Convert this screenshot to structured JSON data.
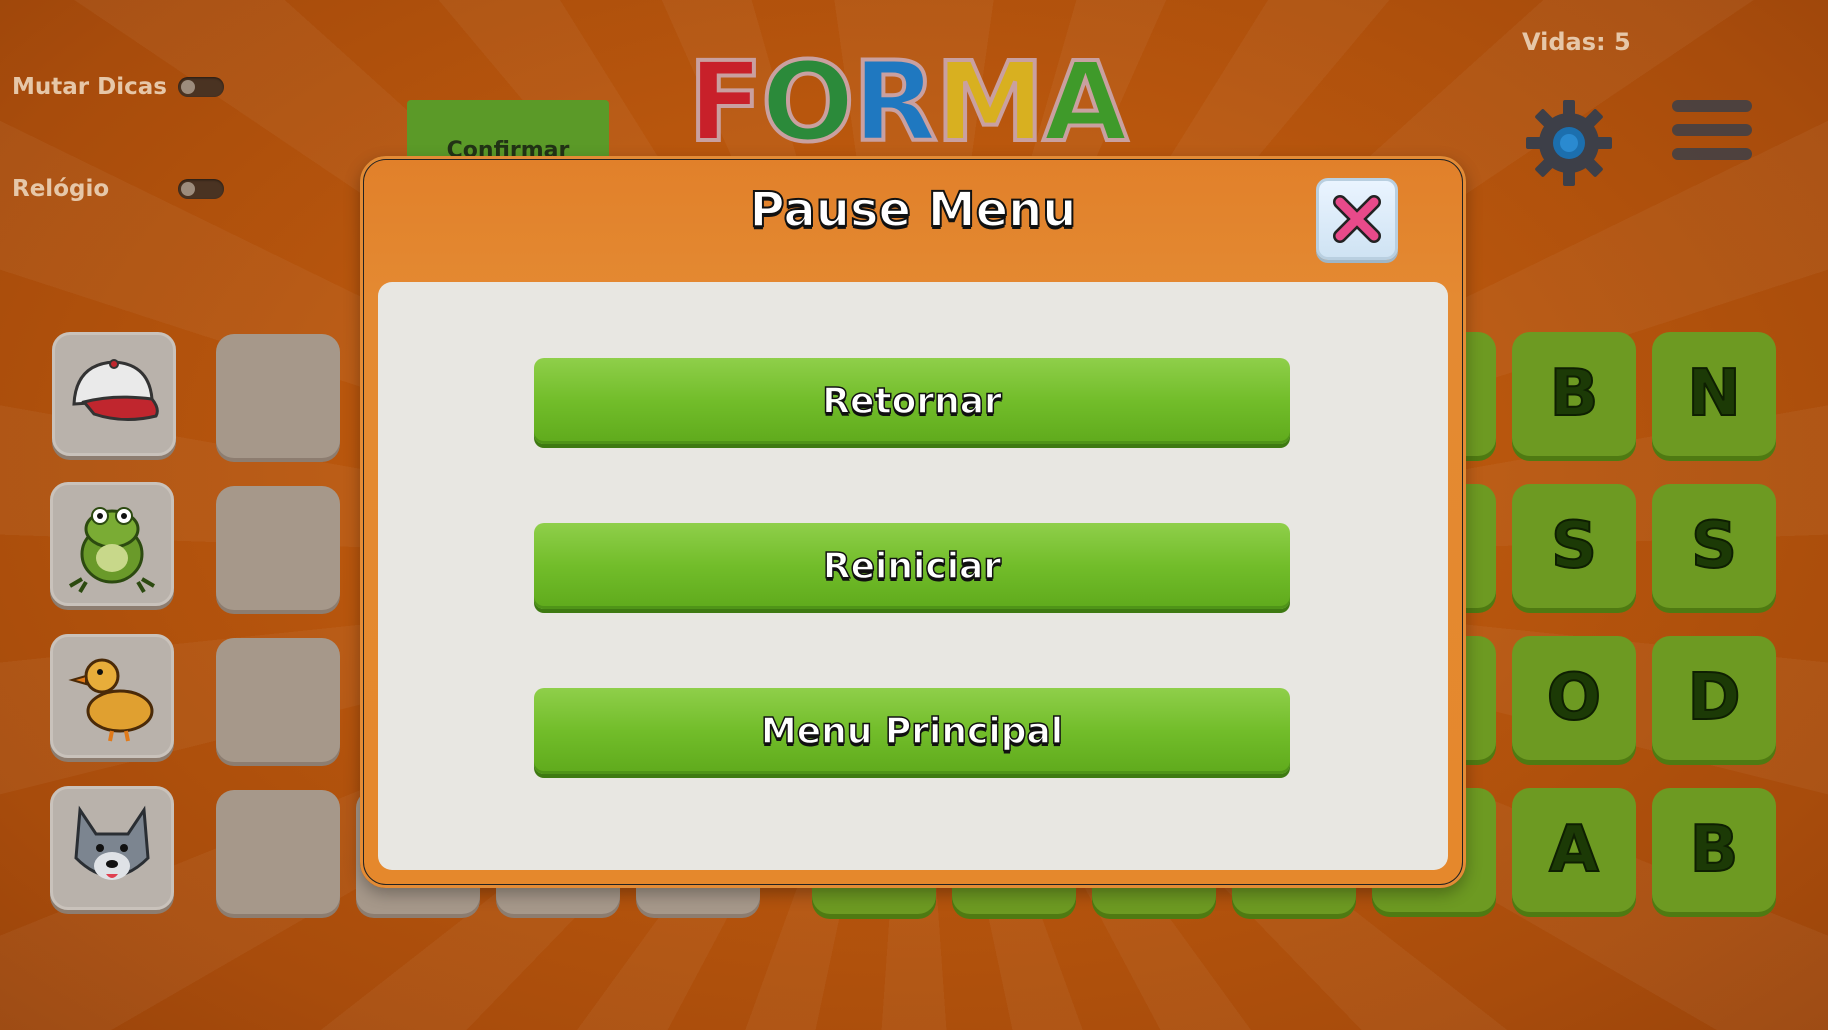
{
  "hud": {
    "mute_hints_label": "Mutar Dicas",
    "clock_label": "Relógio",
    "lives_text": "Vidas: 5",
    "confirm_label": "Confirmar",
    "logo_text": "FORMA"
  },
  "board": {
    "images": [
      "cap-image",
      "frog-image",
      "duck-image",
      "wolf-image"
    ],
    "letters_col1": [
      "B",
      "S",
      "O",
      "A"
    ],
    "letters_col2": [
      "N",
      "S",
      "D",
      "B"
    ]
  },
  "pause_menu": {
    "title": "Pause Menu",
    "buttons": [
      "Retornar",
      "Reiniciar",
      "Menu Principal"
    ]
  },
  "colors": {
    "background": "#b8560d",
    "modal": "#e48a32",
    "button_green": "#72bd2a",
    "letter_tile": "#6d9a22",
    "close_x": "#e84a8a"
  }
}
